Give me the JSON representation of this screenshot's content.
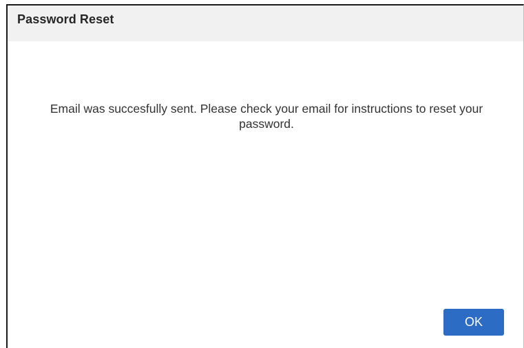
{
  "dialog": {
    "title": "Password Reset",
    "message": "Email was succesfully sent. Please check your email for instructions to reset your password.",
    "ok_label": "OK"
  },
  "colors": {
    "title_bar_bg": "#f1f1f1",
    "button_bg": "#2d6cc4",
    "button_text": "#ffffff",
    "text": "#333333"
  }
}
